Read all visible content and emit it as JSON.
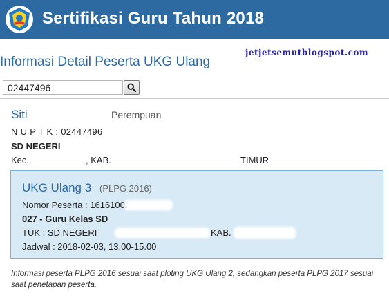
{
  "header": {
    "title": "Sertifikasi Guru Tahun 2018",
    "logo_icon": "tut-wuri-handayani-logo-icon",
    "background": "#2e6aa2"
  },
  "page": {
    "title": "Informasi Detail Peserta UKG Ulang",
    "watermark": "jetjetsemutblogspot.com"
  },
  "search": {
    "value": "02447496",
    "button_icon": "search-icon"
  },
  "participant": {
    "name": "Siti",
    "gender": "Perempuan",
    "nuptk": "N U P T K : 02447496",
    "school": "SD NEGERI",
    "address_start": "Kec.",
    "address_mid": ", KAB.",
    "address_end": "TIMUR"
  },
  "ukg": {
    "title": "UKG Ulang 3",
    "subtitle": "(PLPG 2016)",
    "nomor": "Nomor Peserta : 16161002",
    "kelas": "027 - Guru Kelas SD",
    "tuk": "TUK : SD NEGERI",
    "tuk_kab": "KAB.",
    "jadwal": "Jadwal : 2018-02-03, 13.00-15.00"
  },
  "footnote": "Informasi peserta PLPG 2016 sesuai saat ploting UKG Ulang 2, sedangkan peserta PLPG 2017 sesuai saat penetapan peserta."
}
